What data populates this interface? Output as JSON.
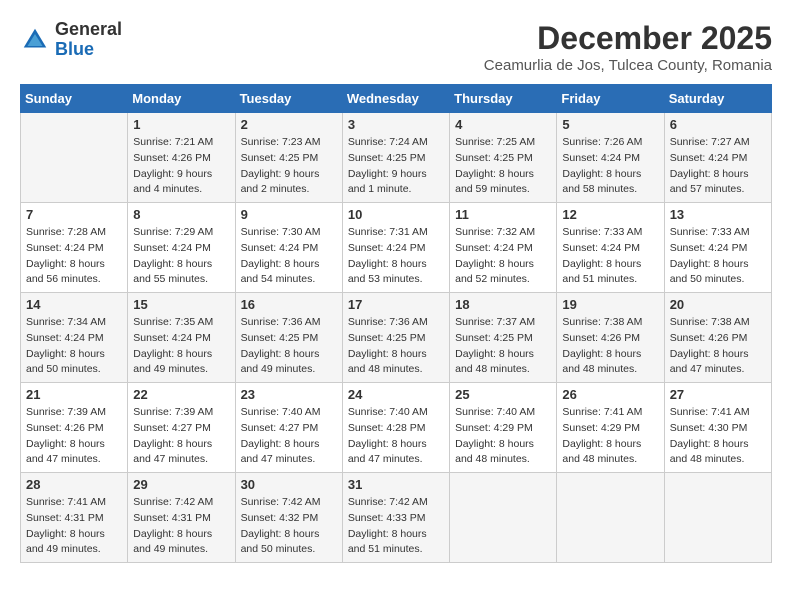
{
  "logo": {
    "general": "General",
    "blue": "Blue"
  },
  "title": "December 2025",
  "location": "Ceamurlia de Jos, Tulcea County, Romania",
  "days_of_week": [
    "Sunday",
    "Monday",
    "Tuesday",
    "Wednesday",
    "Thursday",
    "Friday",
    "Saturday"
  ],
  "weeks": [
    [
      {
        "day": "",
        "info": ""
      },
      {
        "day": "1",
        "info": "Sunrise: 7:21 AM\nSunset: 4:26 PM\nDaylight: 9 hours\nand 4 minutes."
      },
      {
        "day": "2",
        "info": "Sunrise: 7:23 AM\nSunset: 4:25 PM\nDaylight: 9 hours\nand 2 minutes."
      },
      {
        "day": "3",
        "info": "Sunrise: 7:24 AM\nSunset: 4:25 PM\nDaylight: 9 hours\nand 1 minute."
      },
      {
        "day": "4",
        "info": "Sunrise: 7:25 AM\nSunset: 4:25 PM\nDaylight: 8 hours\nand 59 minutes."
      },
      {
        "day": "5",
        "info": "Sunrise: 7:26 AM\nSunset: 4:24 PM\nDaylight: 8 hours\nand 58 minutes."
      },
      {
        "day": "6",
        "info": "Sunrise: 7:27 AM\nSunset: 4:24 PM\nDaylight: 8 hours\nand 57 minutes."
      }
    ],
    [
      {
        "day": "7",
        "info": "Sunrise: 7:28 AM\nSunset: 4:24 PM\nDaylight: 8 hours\nand 56 minutes."
      },
      {
        "day": "8",
        "info": "Sunrise: 7:29 AM\nSunset: 4:24 PM\nDaylight: 8 hours\nand 55 minutes."
      },
      {
        "day": "9",
        "info": "Sunrise: 7:30 AM\nSunset: 4:24 PM\nDaylight: 8 hours\nand 54 minutes."
      },
      {
        "day": "10",
        "info": "Sunrise: 7:31 AM\nSunset: 4:24 PM\nDaylight: 8 hours\nand 53 minutes."
      },
      {
        "day": "11",
        "info": "Sunrise: 7:32 AM\nSunset: 4:24 PM\nDaylight: 8 hours\nand 52 minutes."
      },
      {
        "day": "12",
        "info": "Sunrise: 7:33 AM\nSunset: 4:24 PM\nDaylight: 8 hours\nand 51 minutes."
      },
      {
        "day": "13",
        "info": "Sunrise: 7:33 AM\nSunset: 4:24 PM\nDaylight: 8 hours\nand 50 minutes."
      }
    ],
    [
      {
        "day": "14",
        "info": "Sunrise: 7:34 AM\nSunset: 4:24 PM\nDaylight: 8 hours\nand 50 minutes."
      },
      {
        "day": "15",
        "info": "Sunrise: 7:35 AM\nSunset: 4:24 PM\nDaylight: 8 hours\nand 49 minutes."
      },
      {
        "day": "16",
        "info": "Sunrise: 7:36 AM\nSunset: 4:25 PM\nDaylight: 8 hours\nand 49 minutes."
      },
      {
        "day": "17",
        "info": "Sunrise: 7:36 AM\nSunset: 4:25 PM\nDaylight: 8 hours\nand 48 minutes."
      },
      {
        "day": "18",
        "info": "Sunrise: 7:37 AM\nSunset: 4:25 PM\nDaylight: 8 hours\nand 48 minutes."
      },
      {
        "day": "19",
        "info": "Sunrise: 7:38 AM\nSunset: 4:26 PM\nDaylight: 8 hours\nand 48 minutes."
      },
      {
        "day": "20",
        "info": "Sunrise: 7:38 AM\nSunset: 4:26 PM\nDaylight: 8 hours\nand 47 minutes."
      }
    ],
    [
      {
        "day": "21",
        "info": "Sunrise: 7:39 AM\nSunset: 4:26 PM\nDaylight: 8 hours\nand 47 minutes."
      },
      {
        "day": "22",
        "info": "Sunrise: 7:39 AM\nSunset: 4:27 PM\nDaylight: 8 hours\nand 47 minutes."
      },
      {
        "day": "23",
        "info": "Sunrise: 7:40 AM\nSunset: 4:27 PM\nDaylight: 8 hours\nand 47 minutes."
      },
      {
        "day": "24",
        "info": "Sunrise: 7:40 AM\nSunset: 4:28 PM\nDaylight: 8 hours\nand 47 minutes."
      },
      {
        "day": "25",
        "info": "Sunrise: 7:40 AM\nSunset: 4:29 PM\nDaylight: 8 hours\nand 48 minutes."
      },
      {
        "day": "26",
        "info": "Sunrise: 7:41 AM\nSunset: 4:29 PM\nDaylight: 8 hours\nand 48 minutes."
      },
      {
        "day": "27",
        "info": "Sunrise: 7:41 AM\nSunset: 4:30 PM\nDaylight: 8 hours\nand 48 minutes."
      }
    ],
    [
      {
        "day": "28",
        "info": "Sunrise: 7:41 AM\nSunset: 4:31 PM\nDaylight: 8 hours\nand 49 minutes."
      },
      {
        "day": "29",
        "info": "Sunrise: 7:42 AM\nSunset: 4:31 PM\nDaylight: 8 hours\nand 49 minutes."
      },
      {
        "day": "30",
        "info": "Sunrise: 7:42 AM\nSunset: 4:32 PM\nDaylight: 8 hours\nand 50 minutes."
      },
      {
        "day": "31",
        "info": "Sunrise: 7:42 AM\nSunset: 4:33 PM\nDaylight: 8 hours\nand 51 minutes."
      },
      {
        "day": "",
        "info": ""
      },
      {
        "day": "",
        "info": ""
      },
      {
        "day": "",
        "info": ""
      }
    ]
  ]
}
